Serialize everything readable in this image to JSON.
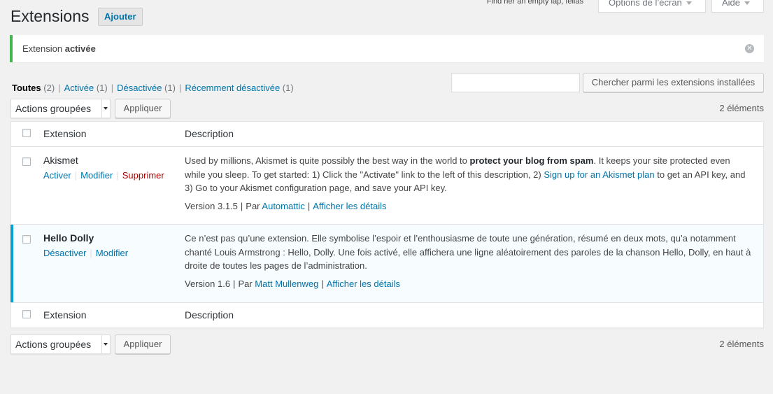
{
  "screen_meta": {
    "dolly_text": "Find her an empty lap, fellas",
    "screen_options_label": "Options de l’écran",
    "help_label": "Aide"
  },
  "page": {
    "title": "Extensions",
    "add_new_label": "Ajouter"
  },
  "notice": {
    "text_prefix": "Extension",
    "text_bold": "activée"
  },
  "views": [
    {
      "label": "Toutes",
      "count": "(2)",
      "current": true
    },
    {
      "label": "Activée",
      "count": "(1)"
    },
    {
      "label": "Désactivée",
      "count": "(1)"
    },
    {
      "label": "Récemment désactivée",
      "count": "(1)"
    }
  ],
  "search": {
    "value": "",
    "button_label": "Chercher parmi les extensions installées"
  },
  "bulk": {
    "select_value": "Actions groupées",
    "apply_label": "Appliquer",
    "items_count": "2 éléments"
  },
  "table": {
    "col_extension": "Extension",
    "col_description": "Description",
    "plugins": [
      {
        "name": "Akismet",
        "status": "inactive",
        "actions": [
          "Activer",
          "Modifier",
          "Supprimer"
        ],
        "description_parts": [
          "Used by millions, Akismet is quite possibly the best way in the world to ",
          "protect your blog from spam",
          ". It keeps your site protected even while you sleep. To get started: 1) Click the \"Activate\" link to the left of this description, 2) ",
          "Sign up for an Akismet plan",
          " to get an API key, and 3) Go to your Akismet configuration page, and save your API key."
        ],
        "version": "Version 3.1.5",
        "by": "Par",
        "author": "Automattic",
        "details": "Afficher les détails"
      },
      {
        "name": "Hello Dolly",
        "status": "active",
        "actions": [
          "Désactiver",
          "Modifier"
        ],
        "description": "Ce n’est pas qu’une extension. Elle symbolise l’espoir et l’enthousiasme de toute une génération, résumé en deux mots, qu’a notamment chanté Louis Armstrong : Hello, Dolly. Une fois activé, elle affichera une ligne aléatoirement des paroles de la chanson Hello, Dolly, en haut à droite de toutes les pages de l’administration.",
        "version": "Version 1.6",
        "by": "Par",
        "author": "Matt Mullenweg",
        "details": "Afficher les détails"
      }
    ]
  },
  "colors": {
    "link": "#0073aa",
    "delete": "#aa0000",
    "notice_success": "#46b450",
    "active_plugin_border": "#00a0d2",
    "active_plugin_bg": "#f7fcfe"
  }
}
